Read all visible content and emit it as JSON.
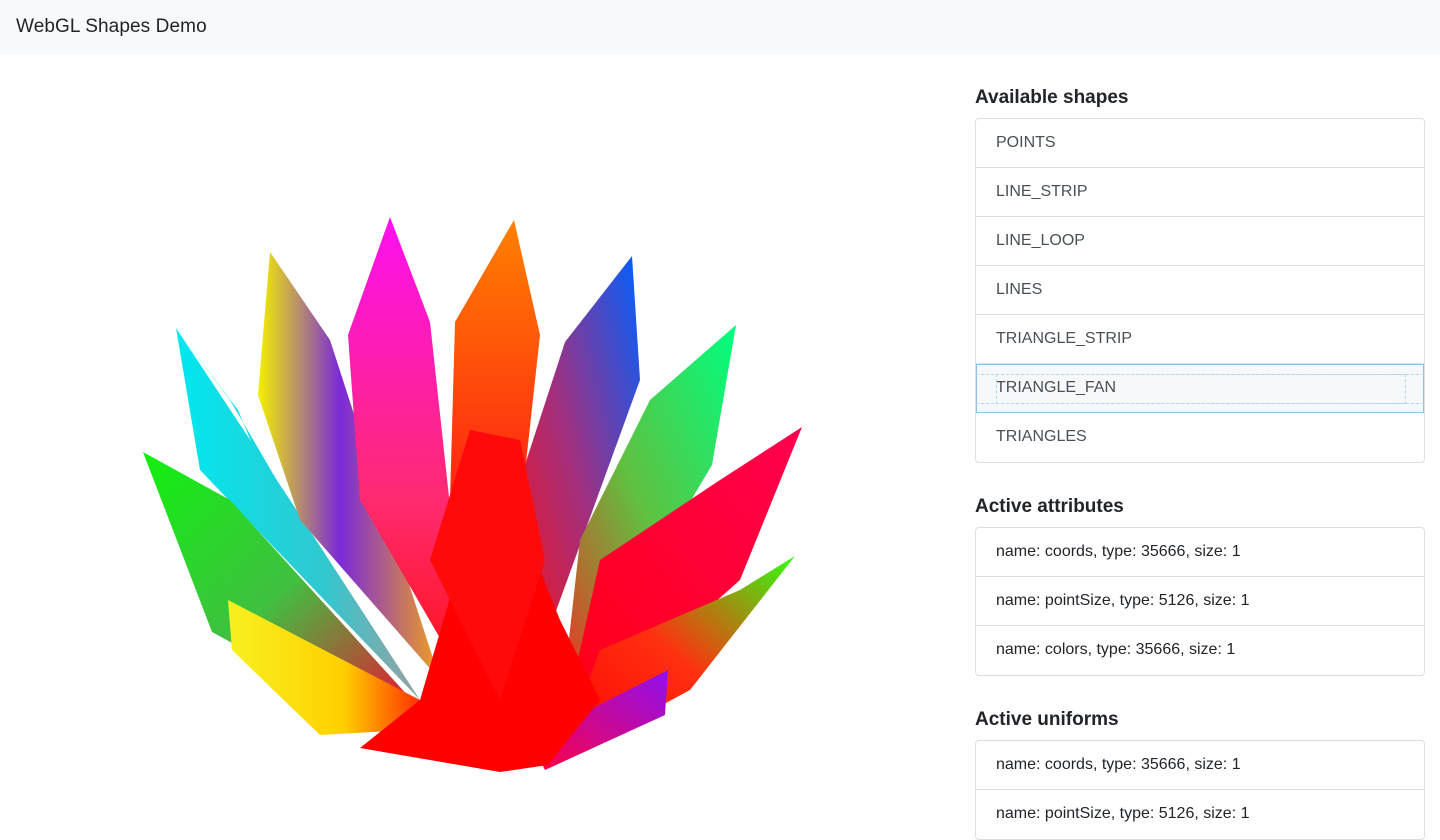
{
  "app": {
    "title": "WebGL Shapes Demo"
  },
  "sections": {
    "shapes": {
      "title": "Available shapes",
      "items": [
        "POINTS",
        "LINE_STRIP",
        "LINE_LOOP",
        "LINES",
        "TRIANGLE_STRIP",
        "TRIANGLE_FAN",
        "TRIANGLES"
      ],
      "selected": "TRIANGLE_FAN"
    },
    "attributes": {
      "title": "Active attributes",
      "items": [
        "name: coords, type: 35666, size: 1",
        "name: pointSize, type: 5126, size: 1",
        "name: colors, type: 35666, size: 1"
      ]
    },
    "uniforms": {
      "title": "Active uniforms",
      "items": [
        "name: coords, type: 35666, size: 1",
        "name: pointSize, type: 5126, size: 1"
      ]
    }
  },
  "colors": {
    "navbar_bg": "#f8f9fa",
    "selection_outline": "#8ec3e6"
  }
}
